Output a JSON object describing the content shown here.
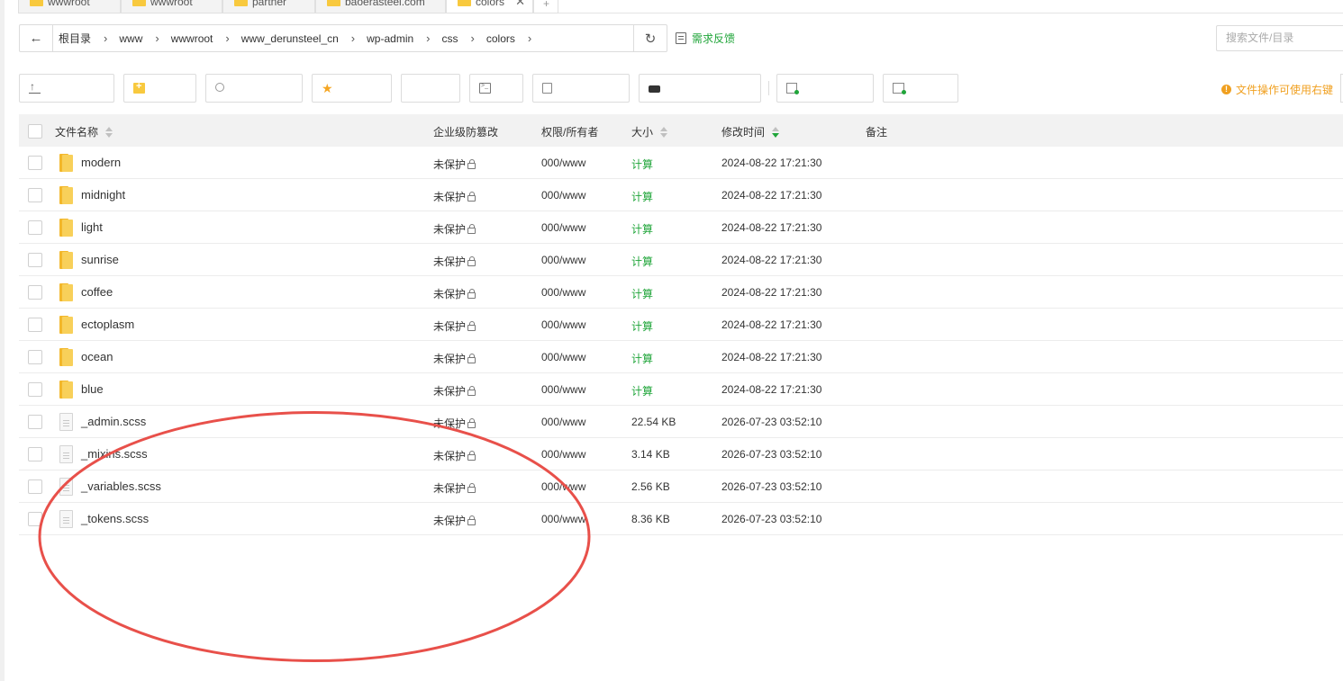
{
  "tabs": [
    {
      "label": "wwwroot",
      "active": false
    },
    {
      "label": "wwwroot",
      "active": false
    },
    {
      "label": "partner",
      "active": false
    },
    {
      "label": "baoerasteel.com",
      "active": false
    },
    {
      "label": "colors",
      "active": true,
      "close": "✕"
    }
  ],
  "tab_add": "+",
  "address": {
    "back": "←",
    "crumbs": [
      "根目录",
      "www",
      "wwwroot",
      "www_derunsteel_cn",
      "wp-admin",
      "css",
      "colors"
    ],
    "refresh": "↻"
  },
  "feedback_label": "需求反馈",
  "search_placeholder": "搜索文件/目录",
  "tip_label": "文件操作可使用右键",
  "columns": {
    "name": "文件名称",
    "protect": "企业级防篡改",
    "perm": "权限/所有者",
    "size": "大小",
    "mtime": "修改时间",
    "note": "备注"
  },
  "rows": [
    {
      "type": "folder",
      "name": "modern",
      "protect": "未保护",
      "perm": "000/www",
      "size": "计算",
      "mtime": "2024-08-22 17:21:30"
    },
    {
      "type": "folder",
      "name": "midnight",
      "protect": "未保护",
      "perm": "000/www",
      "size": "计算",
      "mtime": "2024-08-22 17:21:30"
    },
    {
      "type": "folder",
      "name": "light",
      "protect": "未保护",
      "perm": "000/www",
      "size": "计算",
      "mtime": "2024-08-22 17:21:30"
    },
    {
      "type": "folder",
      "name": "sunrise",
      "protect": "未保护",
      "perm": "000/www",
      "size": "计算",
      "mtime": "2024-08-22 17:21:30"
    },
    {
      "type": "folder",
      "name": "coffee",
      "protect": "未保护",
      "perm": "000/www",
      "size": "计算",
      "mtime": "2024-08-22 17:21:30"
    },
    {
      "type": "folder",
      "name": "ectoplasm",
      "protect": "未保护",
      "perm": "000/www",
      "size": "计算",
      "mtime": "2024-08-22 17:21:30"
    },
    {
      "type": "folder",
      "name": "ocean",
      "protect": "未保护",
      "perm": "000/www",
      "size": "计算",
      "mtime": "2024-08-22 17:21:30"
    },
    {
      "type": "folder",
      "name": "blue",
      "protect": "未保护",
      "perm": "000/www",
      "size": "计算",
      "mtime": "2024-08-22 17:21:30"
    },
    {
      "type": "file",
      "name": "_admin.scss",
      "protect": "未保护",
      "perm": "000/www",
      "size": "22.54 KB",
      "mtime": "2026-07-23 03:52:10"
    },
    {
      "type": "file",
      "name": "_mixins.scss",
      "protect": "未保护",
      "perm": "000/www",
      "size": "3.14 KB",
      "mtime": "2026-07-23 03:52:10"
    },
    {
      "type": "file",
      "name": "_variables.scss",
      "protect": "未保护",
      "perm": "000/www",
      "size": "2.56 KB",
      "mtime": "2026-07-23 03:52:10"
    },
    {
      "type": "file",
      "name": "_tokens.scss",
      "protect": "未保护",
      "perm": "000/www",
      "size": "8.36 KB",
      "mtime": "2026-07-23 03:52:10"
    }
  ],
  "colors": {
    "accent": "#20a53a",
    "warning": "#f0a020",
    "annotation": "#e8504a",
    "folder": "#f8c93e"
  }
}
